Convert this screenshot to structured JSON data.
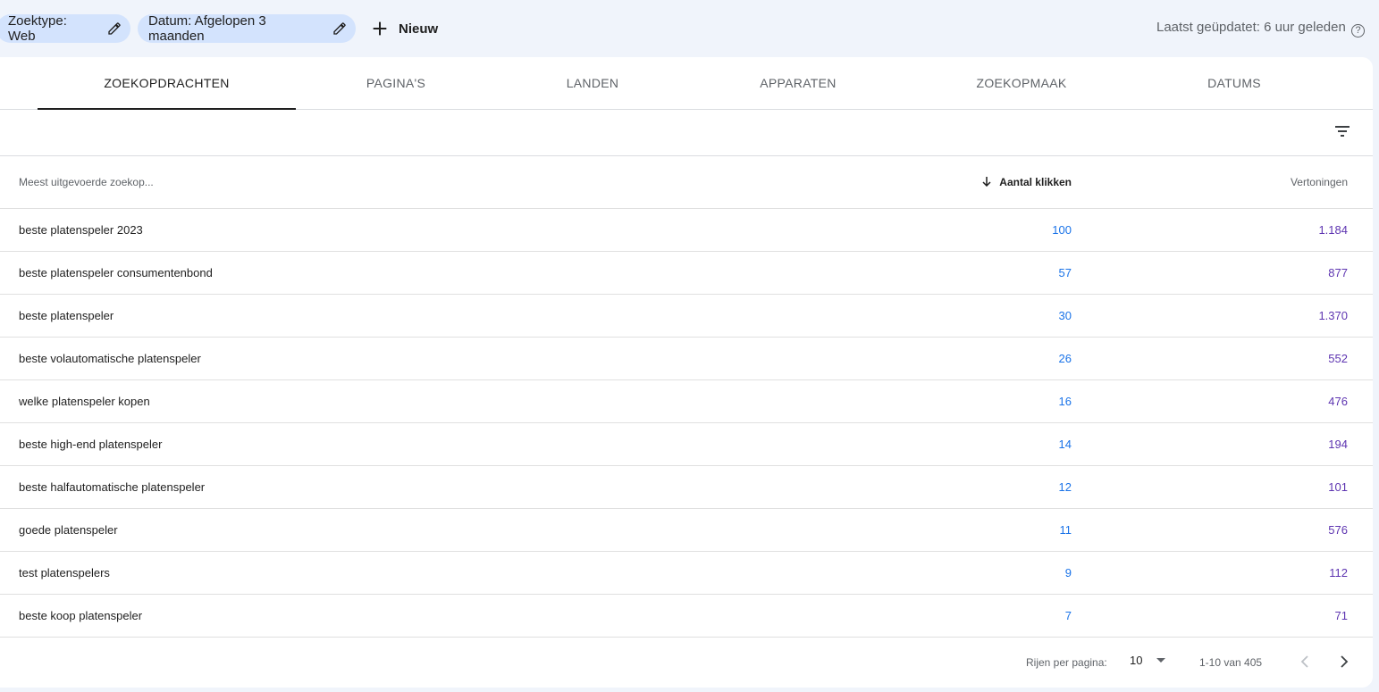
{
  "filters": {
    "search_type": "Zoektype: Web",
    "date": "Datum: Afgelopen 3 maanden",
    "new_label": "Nieuw",
    "last_updated": "Laatst geüpdatet: 6 uur geleden"
  },
  "tabs": [
    {
      "label": "ZOEKOPDRACHTEN",
      "active": true
    },
    {
      "label": "PAGINA'S",
      "active": false
    },
    {
      "label": "LANDEN",
      "active": false
    },
    {
      "label": "APPARATEN",
      "active": false
    },
    {
      "label": "ZOEKOPMAAK",
      "active": false
    },
    {
      "label": "DATUMS",
      "active": false
    }
  ],
  "table": {
    "headers": {
      "query": "Meest uitgevoerde zoekop...",
      "clicks": "Aantal klikken",
      "impressions": "Vertoningen"
    },
    "rows": [
      {
        "query": "beste platenspeler 2023",
        "clicks": "100",
        "impressions": "1.184"
      },
      {
        "query": "beste platenspeler consumentenbond",
        "clicks": "57",
        "impressions": "877"
      },
      {
        "query": "beste platenspeler",
        "clicks": "30",
        "impressions": "1.370"
      },
      {
        "query": "beste volautomatische platenspeler",
        "clicks": "26",
        "impressions": "552"
      },
      {
        "query": "welke platenspeler kopen",
        "clicks": "16",
        "impressions": "476"
      },
      {
        "query": "beste high-end platenspeler",
        "clicks": "14",
        "impressions": "194"
      },
      {
        "query": "beste halfautomatische platenspeler",
        "clicks": "12",
        "impressions": "101"
      },
      {
        "query": "goede platenspeler",
        "clicks": "11",
        "impressions": "576"
      },
      {
        "query": "test platenspelers",
        "clicks": "9",
        "impressions": "112"
      },
      {
        "query": "beste koop platenspeler",
        "clicks": "7",
        "impressions": "71"
      }
    ]
  },
  "pagination": {
    "rows_per_page_label": "Rijen per pagina:",
    "rows_per_page": "10",
    "range": "1-10 van 405"
  },
  "colors": {
    "clicks": "#1a73e8",
    "impressions": "#5e35b1",
    "chip_bg": "#d3e3fd"
  },
  "icons": [
    "pencil-icon",
    "plus-icon",
    "help-icon",
    "filter-icon",
    "arrow-down-icon",
    "caret-down-icon",
    "chevron-left-icon",
    "chevron-right-icon"
  ]
}
